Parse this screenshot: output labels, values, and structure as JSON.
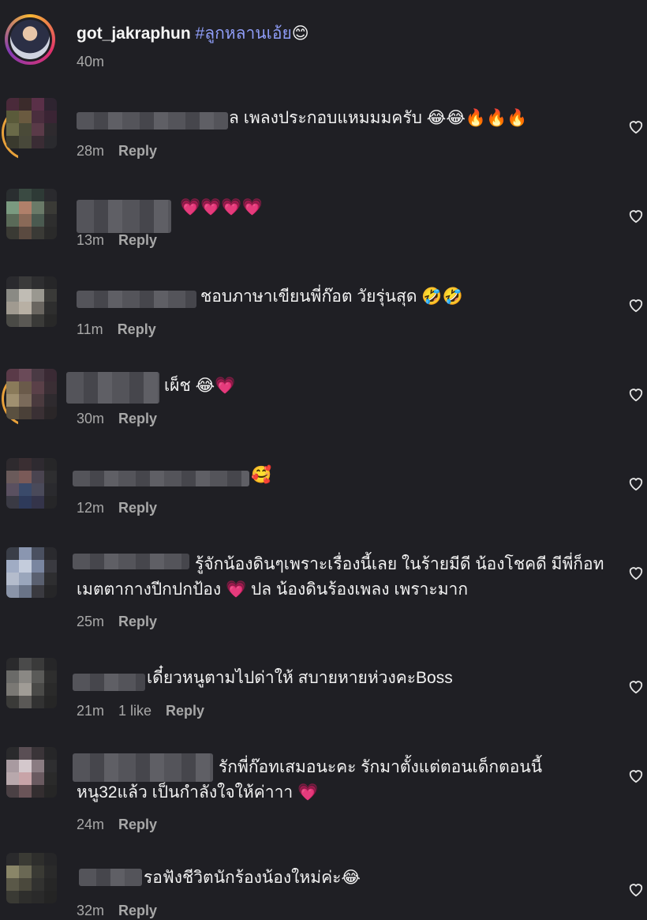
{
  "post": {
    "username": "got_jakraphun",
    "hashtag": "#ลูกหลานเอ้ย",
    "emoji": "😊",
    "time": "40m"
  },
  "comments": [
    {
      "text": "ล เพลงประกอบแหมมมครับ 😂😂🔥🔥🔥",
      "time": "28m",
      "reply": "Reply"
    },
    {
      "text": "💗💗💗💗",
      "time": "13m",
      "reply": "Reply"
    },
    {
      "text": "ชอบภาษาเขียนพี่ก๊อต วัยรุ่นสุด 🤣🤣",
      "time": "11m",
      "reply": "Reply"
    },
    {
      "text": "เผ็ช 😂💗",
      "time": "30m",
      "reply": "Reply"
    },
    {
      "text": "🥰",
      "time": "12m",
      "reply": "Reply"
    },
    {
      "text": "รู้จักน้องดินๆเพราะเรื่องนี้เลย ในร้ายมีดี น้องโชคดี มีพี่ก็อท เมตตากางปีกปกป้อง 💗 ปล น้องดินร้องเพลง เพราะมาก",
      "time": "25m",
      "reply": "Reply"
    },
    {
      "text": "เดี๋ยวหนูตามไปด่าให้ สบายหายห่วงคะBoss",
      "time": "21m",
      "likes": "1 like",
      "reply": "Reply"
    },
    {
      "text": "รักพี่ก๊อทเสมอนะคะ รักมาตั้งแต่ตอนเด็กตอนนี้หนู32แล้ว เป็นกำลังใจให้ค่าาา 💗",
      "time": "24m",
      "reply": "Reply"
    },
    {
      "text": "รอฟังชีวิตนักร้องน้องใหม่ค่ะ😂",
      "time": "32m",
      "reply": "Reply"
    }
  ]
}
